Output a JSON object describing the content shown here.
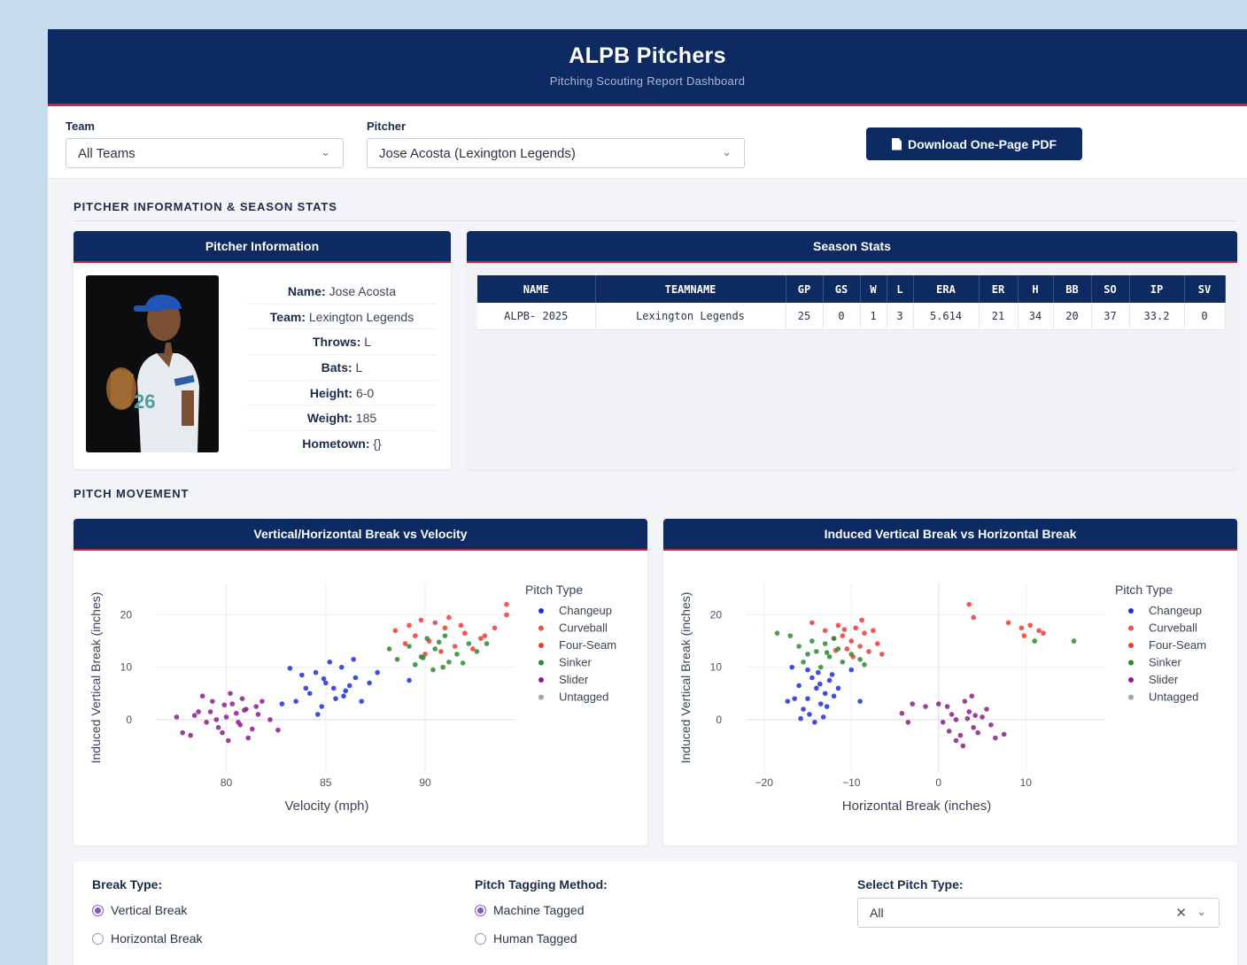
{
  "header": {
    "title": "ALPB Pitchers",
    "subtitle": "Pitching Scouting Report Dashboard"
  },
  "controls": {
    "team_label": "Team",
    "team_value": "All Teams",
    "pitcher_label": "Pitcher",
    "pitcher_value": "Jose Acosta (Lexington Legends)",
    "download_label": "Download One-Page PDF"
  },
  "section_info": "PITCHER INFORMATION & SEASON STATS",
  "pitcher_info": {
    "card_title": "Pitcher Information",
    "rows": [
      {
        "key": "Name:",
        "value": "Jose Acosta"
      },
      {
        "key": "Team:",
        "value": "Lexington Legends"
      },
      {
        "key": "Throws:",
        "value": "L"
      },
      {
        "key": "Bats:",
        "value": "L"
      },
      {
        "key": "Height:",
        "value": "6-0"
      },
      {
        "key": "Weight:",
        "value": "185"
      },
      {
        "key": "Hometown:",
        "value": "{}"
      }
    ]
  },
  "season_stats": {
    "card_title": "Season Stats",
    "columns": [
      "NAME",
      "TEAMNAME",
      "GP",
      "GS",
      "W",
      "L",
      "ERA",
      "ER",
      "H",
      "BB",
      "SO",
      "IP",
      "SV"
    ],
    "row": [
      "ALPB- 2025",
      "Lexington Legends",
      "25",
      "0",
      "1",
      "3",
      "5.614",
      "21",
      "34",
      "20",
      "37",
      "33.2",
      "0"
    ]
  },
  "section_movement": "PITCH MOVEMENT",
  "legend": {
    "title": "Pitch Type",
    "items": [
      {
        "name": "Changeup",
        "color": "#1f2ee0"
      },
      {
        "name": "Curveball",
        "color": "#e8524f"
      },
      {
        "name": "Four-Seam",
        "color": "#f03a32"
      },
      {
        "name": "Sinker",
        "color": "#2e8b2e"
      },
      {
        "name": "Slider",
        "color": "#8b1e8b"
      },
      {
        "name": "Untagged",
        "color": "#a6a6a6"
      }
    ]
  },
  "chart_data": [
    {
      "type": "scatter",
      "title": "Vertical/Horizontal Break vs Velocity",
      "xlabel": "Velocity (mph)",
      "ylabel": "Induced Vertical Break (inches)",
      "xlim": [
        76.5,
        94.5
      ],
      "ylim": [
        -10,
        26
      ],
      "xticks": [
        80,
        85,
        90
      ],
      "yticks": [
        0,
        10,
        20
      ],
      "legend_position": "right",
      "grid": true,
      "series": [
        {
          "name": "Slider",
          "points": [
            [
              79.2,
              1.5
            ],
            [
              80.0,
              0.5
            ],
            [
              80.3,
              3.0
            ],
            [
              79.6,
              -1.5
            ],
            [
              80.6,
              -0.5
            ],
            [
              81.0,
              2.0
            ],
            [
              79.0,
              -0.5
            ],
            [
              81.6,
              1.0
            ],
            [
              78.6,
              1.5
            ],
            [
              80.8,
              4.0
            ],
            [
              79.8,
              -2.5
            ],
            [
              81.3,
              -1.8
            ],
            [
              78.2,
              -3.0
            ],
            [
              80.5,
              1.2
            ],
            [
              79.3,
              3.5
            ],
            [
              81.8,
              3.5
            ],
            [
              82.2,
              0.0
            ],
            [
              77.5,
              0.5
            ],
            [
              80.1,
              -4.0
            ],
            [
              78.8,
              4.5
            ],
            [
              80.9,
              1.8
            ],
            [
              79.5,
              0.0
            ],
            [
              81.5,
              2.5
            ],
            [
              80.2,
              5.0
            ],
            [
              82.6,
              -2.0
            ],
            [
              77.8,
              -2.5
            ],
            [
              79.9,
              2.8
            ],
            [
              81.1,
              -3.5
            ],
            [
              78.4,
              0.8
            ],
            [
              80.7,
              -1.0
            ]
          ]
        },
        {
          "name": "Changeup",
          "points": [
            [
              84.0,
              6.0
            ],
            [
              85.0,
              7.0
            ],
            [
              85.5,
              4.0
            ],
            [
              84.5,
              9.0
            ],
            [
              86.0,
              5.5
            ],
            [
              83.5,
              3.5
            ],
            [
              85.8,
              10.0
            ],
            [
              86.5,
              8.0
            ],
            [
              84.8,
              2.5
            ],
            [
              86.8,
              3.5
            ],
            [
              85.2,
              11.0
            ],
            [
              83.8,
              8.5
            ],
            [
              84.2,
              5.0
            ],
            [
              86.2,
              6.5
            ],
            [
              87.2,
              7.0
            ],
            [
              84.6,
              1.0
            ],
            [
              85.4,
              6.0
            ],
            [
              83.2,
              9.8
            ],
            [
              86.4,
              11.5
            ],
            [
              82.8,
              3.0
            ],
            [
              85.9,
              4.5
            ],
            [
              84.9,
              7.8
            ],
            [
              87.6,
              9.0
            ],
            [
              89.2,
              7.5
            ]
          ]
        },
        {
          "name": "Four-Seam",
          "points": [
            [
              89.5,
              16.0
            ],
            [
              90.2,
              15.0
            ],
            [
              91.0,
              17.5
            ],
            [
              89.0,
              14.5
            ],
            [
              90.5,
              18.5
            ],
            [
              91.5,
              14.0
            ],
            [
              92.0,
              16.5
            ],
            [
              90.8,
              13.0
            ],
            [
              89.8,
              19.0
            ],
            [
              92.8,
              15.5
            ],
            [
              93.5,
              17.5
            ],
            [
              94.1,
              20.0
            ],
            [
              94.1,
              22.0
            ],
            [
              88.5,
              17.0
            ],
            [
              91.2,
              19.5
            ],
            [
              90.0,
              12.5
            ],
            [
              92.4,
              13.5
            ],
            [
              89.2,
              18.0
            ],
            [
              93.0,
              16.0
            ],
            [
              91.8,
              18.0
            ]
          ]
        },
        {
          "name": "Sinker",
          "points": [
            [
              89.8,
              12.0
            ],
            [
              90.5,
              13.5
            ],
            [
              91.2,
              11.0
            ],
            [
              89.2,
              14.0
            ],
            [
              90.9,
              10.0
            ],
            [
              91.6,
              12.5
            ],
            [
              88.6,
              11.5
            ],
            [
              90.1,
              15.5
            ],
            [
              92.2,
              14.5
            ],
            [
              89.5,
              10.5
            ],
            [
              91.0,
              16.0
            ],
            [
              92.6,
              13.0
            ],
            [
              88.2,
              13.5
            ],
            [
              90.4,
              9.5
            ],
            [
              93.1,
              14.5
            ],
            [
              89.9,
              11.8
            ],
            [
              91.9,
              10.8
            ],
            [
              90.7,
              14.8
            ]
          ]
        }
      ]
    },
    {
      "type": "scatter",
      "title": "Induced Vertical Break vs Horizontal Break",
      "xlabel": "Horizontal Break (inches)",
      "ylabel": "Induced Vertical Break (inches)",
      "xlim": [
        -22,
        19
      ],
      "ylim": [
        -10,
        26
      ],
      "xticks": [
        -20,
        -10,
        0,
        10
      ],
      "yticks": [
        0,
        10,
        20
      ],
      "legend_position": "right",
      "grid": true,
      "series": [
        {
          "name": "Changeup",
          "points": [
            [
              -14.0,
              6.0
            ],
            [
              -13.0,
              5.0
            ],
            [
              -15.0,
              4.0
            ],
            [
              -12.5,
              7.5
            ],
            [
              -14.5,
              8.0
            ],
            [
              -13.5,
              3.0
            ],
            [
              -16.0,
              6.5
            ],
            [
              -12.0,
              4.5
            ],
            [
              -15.5,
              2.0
            ],
            [
              -13.8,
              9.0
            ],
            [
              -14.8,
              1.0
            ],
            [
              -12.8,
              2.5
            ],
            [
              -16.5,
              4.0
            ],
            [
              -11.5,
              6.0
            ],
            [
              -15.0,
              9.5
            ],
            [
              -13.2,
              0.5
            ],
            [
              -14.2,
              -0.5
            ],
            [
              -16.8,
              10.0
            ],
            [
              -17.3,
              3.5
            ],
            [
              -10.0,
              9.5
            ],
            [
              -9.0,
              3.5
            ],
            [
              -12.2,
              8.6
            ],
            [
              -15.8,
              0.2
            ],
            [
              -13.6,
              6.8
            ]
          ]
        },
        {
          "name": "Four-Seam",
          "points": [
            [
              -10.0,
              15.0
            ],
            [
              -9.0,
              14.0
            ],
            [
              -11.0,
              16.0
            ],
            [
              -8.5,
              16.5
            ],
            [
              -10.5,
              13.5
            ],
            [
              -9.5,
              17.5
            ],
            [
              -12.0,
              15.5
            ],
            [
              -8.0,
              13.0
            ],
            [
              -7.0,
              14.5
            ],
            [
              -11.5,
              18.0
            ],
            [
              -6.5,
              12.5
            ],
            [
              -13.0,
              17.0
            ],
            [
              -7.5,
              17.0
            ],
            [
              -9.8,
              12.0
            ],
            [
              -14.5,
              18.5
            ],
            [
              -8.8,
              19.0
            ],
            [
              -10.8,
              17.2
            ],
            [
              3.5,
              22.0
            ],
            [
              4.0,
              19.5
            ],
            [
              8.0,
              18.5
            ],
            [
              9.5,
              17.5
            ],
            [
              10.5,
              18.0
            ],
            [
              11.5,
              17.0
            ],
            [
              9.8,
              16.0
            ],
            [
              12.0,
              16.5
            ],
            [
              -11.8,
              13.2
            ]
          ]
        },
        {
          "name": "Sinker",
          "points": [
            [
              -12.5,
              12.0
            ],
            [
              -14.0,
              13.0
            ],
            [
              -11.0,
              11.0
            ],
            [
              -13.0,
              14.5
            ],
            [
              -15.0,
              12.5
            ],
            [
              -12.0,
              15.5
            ],
            [
              -10.0,
              12.5
            ],
            [
              -16.0,
              14.0
            ],
            [
              -13.5,
              10.0
            ],
            [
              -9.0,
              11.5
            ],
            [
              -17.0,
              16.0
            ],
            [
              -18.5,
              16.5
            ],
            [
              -11.5,
              13.5
            ],
            [
              -14.5,
              15.0
            ],
            [
              -8.5,
              10.5
            ],
            [
              -15.5,
              11.0
            ],
            [
              15.5,
              15.0
            ],
            [
              11.0,
              15.0
            ],
            [
              -12.8,
              12.8
            ]
          ]
        },
        {
          "name": "Slider",
          "points": [
            [
              2.0,
              0.0
            ],
            [
              3.5,
              1.5
            ],
            [
              1.0,
              2.5
            ],
            [
              4.0,
              -1.5
            ],
            [
              2.5,
              -3.0
            ],
            [
              5.0,
              0.5
            ],
            [
              0.5,
              -0.5
            ],
            [
              3.0,
              3.5
            ],
            [
              4.5,
              -2.5
            ],
            [
              1.5,
              1.0
            ],
            [
              6.0,
              -1.0
            ],
            [
              2.0,
              -4.0
            ],
            [
              3.8,
              4.5
            ],
            [
              5.5,
              2.0
            ],
            [
              0.0,
              3.0
            ],
            [
              6.5,
              -3.5
            ],
            [
              1.2,
              -2.2
            ],
            [
              4.2,
              0.8
            ],
            [
              -3.5,
              -0.5
            ],
            [
              -4.2,
              1.2
            ],
            [
              -3.0,
              3.0
            ],
            [
              -1.5,
              2.5
            ],
            [
              7.5,
              -2.8
            ],
            [
              2.8,
              -5.0
            ],
            [
              3.3,
              0.2
            ]
          ]
        }
      ]
    }
  ],
  "filters": {
    "break_label": "Break Type:",
    "break_options": [
      "Vertical Break",
      "Horizontal Break"
    ],
    "tagging_label": "Pitch Tagging Method:",
    "tagging_options": [
      "Machine Tagged",
      "Human Tagged"
    ],
    "pitch_type_label": "Select Pitch Type:",
    "pitch_type_value": "All",
    "clear_glyph": "✕",
    "chevron_glyph": "⌄"
  }
}
